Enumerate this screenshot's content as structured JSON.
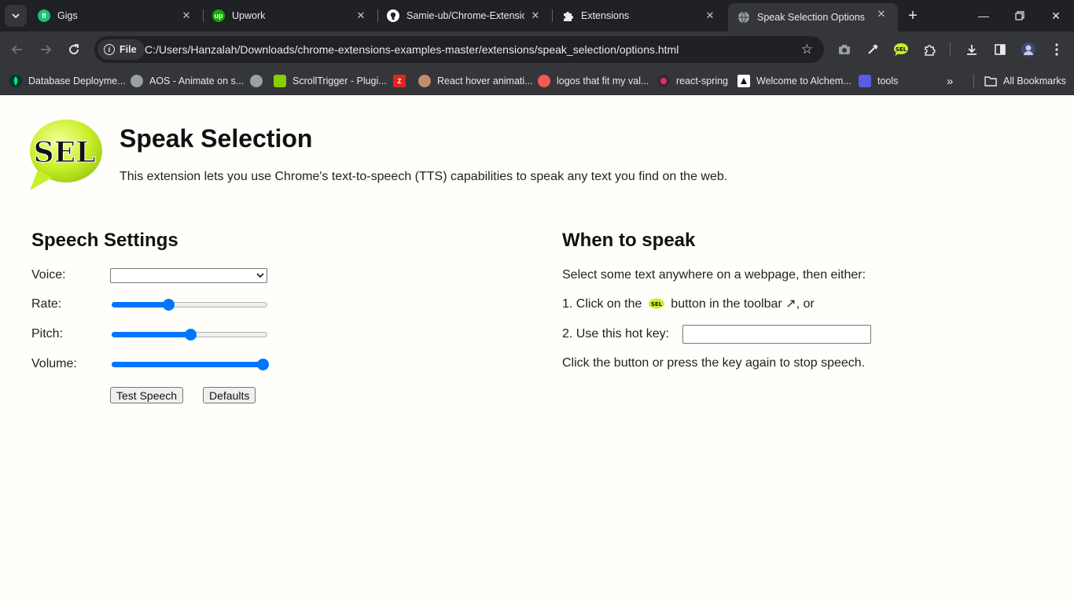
{
  "tabs": [
    {
      "label": "Gigs",
      "icon": "fiverr-icon",
      "color": "#1dbf73",
      "glyph": "fi"
    },
    {
      "label": "Upwork",
      "icon": "upwork-icon",
      "color": "#14a800",
      "glyph": "up"
    },
    {
      "label": "Samie-ub/Chrome-Extension",
      "icon": "github-icon",
      "color": "#ffffff",
      "glyph": ""
    },
    {
      "label": "Extensions",
      "icon": "puzzle-icon",
      "color": "#e8eaed",
      "glyph": ""
    },
    {
      "label": "Speak Selection Options",
      "icon": "globe-icon",
      "color": "#9aa0a6",
      "glyph": ""
    }
  ],
  "omnibox": {
    "chip_label": "File",
    "url": "C:/Users/Hanzalah/Downloads/chrome-extensions-examples-master/extensions/speak_selection/options.html"
  },
  "bookmarks": [
    {
      "label": "Database Deployme...",
      "color": "#00ed64"
    },
    {
      "label": "AOS - Animate on s...",
      "color": "#9aa0a6"
    },
    {
      "label": "",
      "color": "#9aa0a6"
    },
    {
      "label": "ScrollTrigger - Plugi...",
      "color": "#88ce02"
    },
    {
      "label": "",
      "color": "#e02424"
    },
    {
      "label": "React hover animati...",
      "color": "#c58c6b"
    },
    {
      "label": "logos that fit my val...",
      "color": "#f25c54"
    },
    {
      "label": "react-spring",
      "color": "#d6336c"
    },
    {
      "label": "Welcome to Alchem...",
      "color": "#ffffff"
    },
    {
      "label": "tools",
      "color": "#5b5be8"
    }
  ],
  "all_bookmarks_label": "All Bookmarks",
  "page": {
    "title": "Speak Selection",
    "description": "This extension lets you use Chrome's text-to-speech (TTS) capabilities to speak any text you find on the web.",
    "logo_text": "SEL"
  },
  "speech_settings": {
    "heading": "Speech Settings",
    "voice_label": "Voice:",
    "voice_value": "",
    "rate_label": "Rate:",
    "rate_level": 0.35,
    "pitch_label": "Pitch:",
    "pitch_level": 0.5,
    "volume_label": "Volume:",
    "volume_level": 1.0,
    "test_button": "Test Speech",
    "defaults_button": "Defaults"
  },
  "when_to_speak": {
    "heading": "When to speak",
    "intro": "Select some text anywhere on a webpage, then either:",
    "step1_prefix": "1. Click on the",
    "step1_suffix": "button in the toolbar ↗, or",
    "step2_label": "2. Use this hot key:",
    "hotkey_value": "",
    "outro": "Click the button or press the key again to stop speech."
  },
  "colors": {
    "accent": "#0075ff",
    "chrome_dark": "#202124",
    "chrome_mid": "#35363a",
    "logo_green": "#c8f02a"
  }
}
